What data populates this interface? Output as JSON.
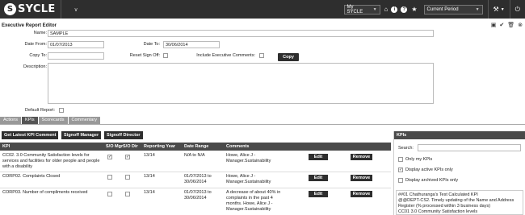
{
  "app": {
    "logo_letter": "S",
    "logo_text": "SYCLE",
    "caret": "∨",
    "my_sycle": "My SYCLE",
    "period": "Current Period"
  },
  "editor": {
    "title": "Executive Report Editor"
  },
  "form": {
    "name_label": "Name:",
    "name_value": "SAMPLE",
    "date_from_label": "Date From:",
    "date_from_value": "01/07/2013",
    "date_to_label": "Date To:",
    "date_to_value": "30/06/2014",
    "copy_to_label": "Copy To:",
    "reset_signoff_label": "Reset Sign Off:",
    "include_exec_label": "Include Executive Comments:",
    "copy_button": "Copy",
    "description_label": "Description:",
    "default_report_label": "Default Report:"
  },
  "tabs": [
    "Actions",
    "KPIs",
    "Scorecards",
    "Commentary"
  ],
  "actions": {
    "get_latest": "Get Latest KPI Comment",
    "signoff_manager": "Signoff Manager",
    "signoff_director": "Signoff Director"
  },
  "table": {
    "headers": [
      "KPI",
      "S/O Mgr",
      "S/O Dir",
      "Reporting Year",
      "Date Range",
      "Comments"
    ],
    "edit_label": "Edit",
    "remove_label": "Remove",
    "rows": [
      {
        "kpi": "CC02. 3.0 Community Satisfaction levels for services and facilities for older people and people with a disability",
        "year": "13/14",
        "date_range": "N/A to N/A",
        "comments": "Howe, Alice J - Manager.Sustainability",
        "mgr": true,
        "dir": true
      },
      {
        "kpi": "CORP02. Complaints Closed",
        "year": "13/14",
        "date_range": "01/07/2013 to 30/06/2014",
        "comments": "Howe, Alice J - Manager.Sustainability",
        "mgr": false,
        "dir": false
      },
      {
        "kpi": "CORP03. Number of compliments received",
        "year": "13/14",
        "date_range": "01/07/2013 to 30/06/2014",
        "comments": "A decrease of about 40% in complaints in the past 4 months. Howe, Alice J - Manager.Sustainability",
        "mgr": false,
        "dir": false
      }
    ]
  },
  "sidebar": {
    "title": "KPIs",
    "search_label": "Search:",
    "only_my_kpis": "Only my KPIs",
    "display_active": "Display active KPIs only",
    "display_archived": "Display archived KPIs only",
    "list": [
      "##01 Chathuranga's Test Calculated KPI",
      "@@DEPT-CS2. Timely updating of the Name and Address Register (% processed within 3 business days)",
      "CC01 3.0 Community Satisfaction levels"
    ]
  }
}
